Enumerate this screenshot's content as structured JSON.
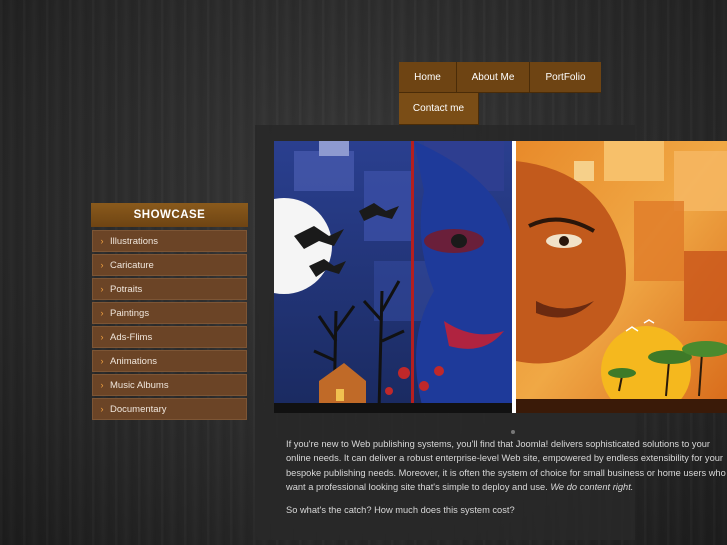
{
  "nav": {
    "items": [
      {
        "label": "Home"
      },
      {
        "label": "About Me"
      },
      {
        "label": "PortFolio"
      },
      {
        "label": "Contact me"
      }
    ]
  },
  "showcase": {
    "title": "SHOWCASE",
    "items": [
      {
        "label": "Illustrations"
      },
      {
        "label": "Caricature"
      },
      {
        "label": "Potraits"
      },
      {
        "label": "Paintings"
      },
      {
        "label": "Ads-Flims"
      },
      {
        "label": "Animations"
      },
      {
        "label": "Music Albums"
      },
      {
        "label": "Documentary"
      }
    ]
  },
  "content": {
    "paragraph1": "If you're new to Web publishing systems, you'll find that Joomla! delivers sophisticated solutions to your online needs. It can deliver a robust enterprise-level Web site, empowered by endless extensibility for your bespoke publishing needs. Moreover, it is often the system of choice for small business or home users who want a professional looking site that's simple to deploy and use.",
    "paragraph1_emphasis": "We do content right.",
    "paragraph2": "So what's the catch? How much does this system cost?"
  },
  "colors": {
    "accent_brown": "#6e4413",
    "chevron_orange": "#f3a340"
  }
}
